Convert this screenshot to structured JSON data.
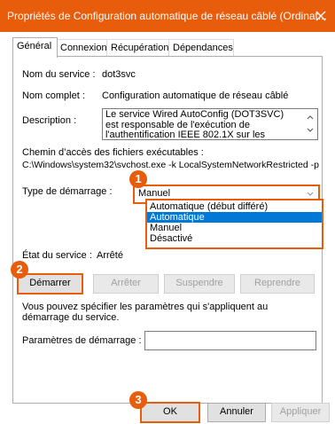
{
  "window": {
    "title": "Propriétés de Configuration automatique de réseau câblé (Ordinat..."
  },
  "tabs": [
    {
      "label": "Général"
    },
    {
      "label": "Connexion"
    },
    {
      "label": "Récupération"
    },
    {
      "label": "Dépendances"
    }
  ],
  "general": {
    "service_name_label": "Nom du service :",
    "service_name_value": "dot3svc",
    "display_name_label": "Nom complet :",
    "display_name_value": "Configuration automatique de réseau câblé",
    "description_label": "Description :",
    "description_value": "Le service Wired AutoConfig (DOT3SVC) est responsable de l'exécution de l'authentification IEEE 802.1X sur les interfaces Ethernet. Si votre",
    "path_label": "Chemin d’accès des fichiers exécutables :",
    "path_value": "C:\\Windows\\system32\\svchost.exe -k LocalSystemNetworkRestricted -p",
    "startup_type_label": "Type de démarrage :",
    "startup_type_value": "Manuel",
    "startup_options": [
      "Automatique (début différé)",
      "Automatique",
      "Manuel",
      "Désactivé"
    ],
    "startup_selected_index": 1,
    "status_label": "État du service :",
    "status_value": "Arrêté",
    "start_button": "Démarrer",
    "stop_button": "Arrêter",
    "pause_button": "Suspendre",
    "resume_button": "Reprendre",
    "params_info": "Vous pouvez spécifier les paramètres qui s'appliquent au démarrage du service.",
    "params_label": "Paramètres de démarrage :",
    "params_value": ""
  },
  "footer": {
    "ok": "OK",
    "cancel": "Annuler",
    "apply": "Appliquer"
  },
  "markers": [
    "1",
    "2",
    "3"
  ],
  "colors": {
    "accent": "#E85D0C",
    "selection": "#0078D7"
  },
  "icons": {
    "close": "close-icon",
    "dropdown": "chevron-down-icon",
    "scroll_up": "chevron-up-icon",
    "scroll_down": "chevron-down-icon"
  }
}
